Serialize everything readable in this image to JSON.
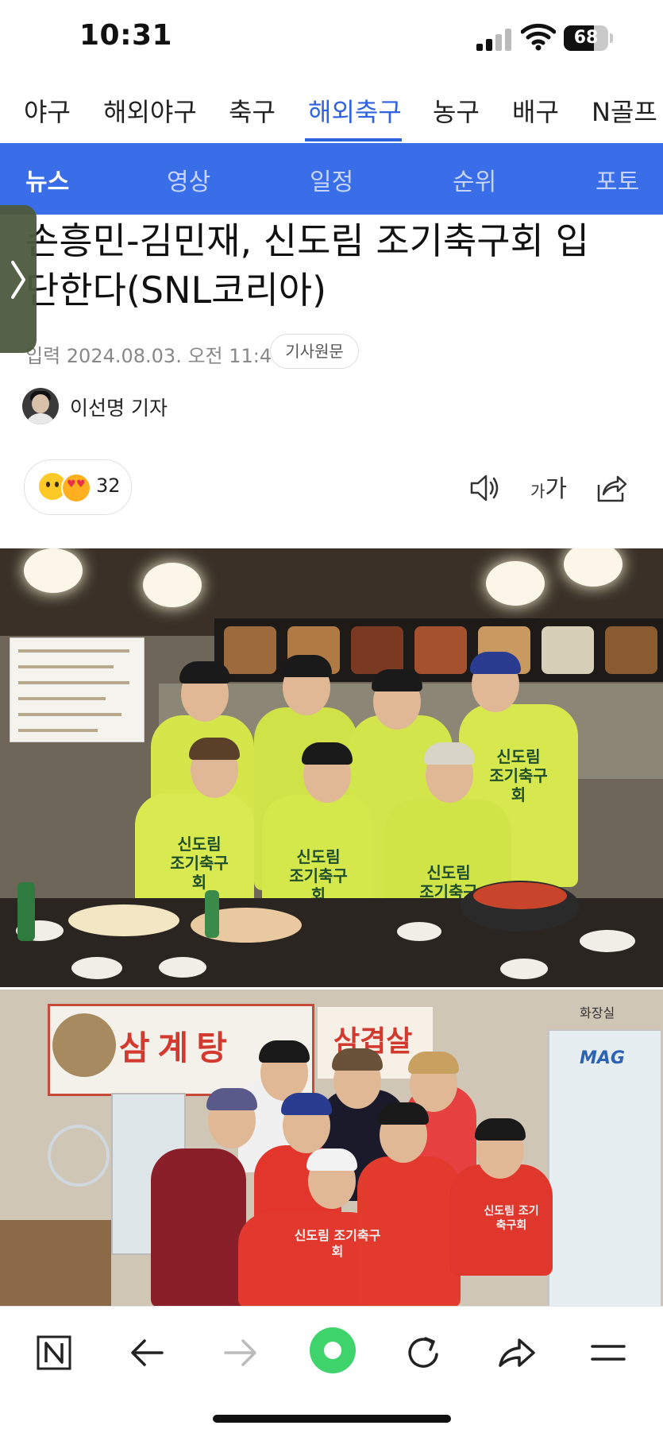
{
  "status_bar": {
    "time": "10:31",
    "battery": "68",
    "battery_level_percent": 68
  },
  "sport_tabs": [
    "야구",
    "해외야구",
    "축구",
    "해외축구",
    "농구",
    "배구",
    "N골프"
  ],
  "sport_tab_active": "해외축구",
  "sub_tabs": [
    "뉴스",
    "영상",
    "일정",
    "순위",
    "포토"
  ],
  "sub_tab_active": "뉴스",
  "article": {
    "headline_line1": "손흥민-김민재, 신도림 조기축구회 입",
    "headline_line2": "단한다(SNL코리아)",
    "date": "입력 2024.08.03. 오전 11:47",
    "original_button": "기사원문",
    "reporter": "이선명 기자",
    "reaction_count": "32"
  },
  "tools": {
    "font_small": "가",
    "font_large": "가"
  },
  "photo1": {
    "jersey_text": "신도림\n조기축구회"
  },
  "photo2": {
    "sign_text": "삼계탕",
    "sign2_text": "삼겹살",
    "fridge_label": "MAG",
    "restroom_label": "화장실",
    "jersey_text": "신도림 조기축구회"
  },
  "icons": {
    "side_handle": "chevron-right-icon",
    "speaker": "speaker-icon",
    "share": "share-icon",
    "bottom": [
      "naver-n-icon",
      "back-arrow-icon",
      "forward-arrow-icon",
      "green-home-icon",
      "reload-icon",
      "share-arrow-icon",
      "menu-icon"
    ]
  },
  "colors": {
    "accent_blue": "#2f63e0",
    "subnav_blue": "#3a6ee8",
    "green_dot": "#3fd36c"
  }
}
